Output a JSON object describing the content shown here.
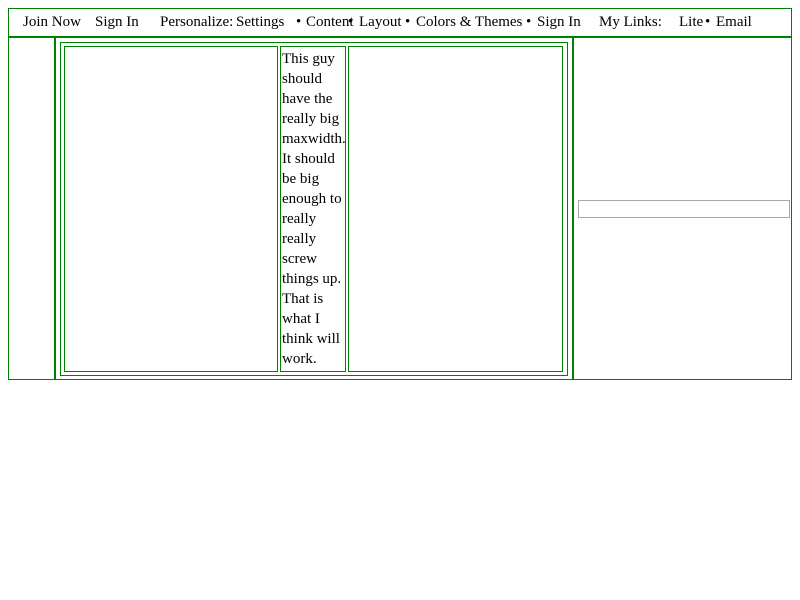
{
  "topbar": {
    "join_now": "Join Now",
    "sign_in": "Sign In",
    "personalize_label": "Personalize:",
    "personalize_links": {
      "settings": "Settings",
      "content": "Content",
      "layout": "Layout",
      "colors_themes": "Colors & Themes",
      "sign_in": "Sign In"
    },
    "separator": "•",
    "my_links_label": "My Links:",
    "my_links": {
      "lite": "Lite",
      "email": "Email"
    }
  },
  "main": {
    "middle_cell_text": "This guy should have the really big maxwidth. It should be big enough to really really screw things up. That is what I think will work."
  },
  "right": {
    "input_value": ""
  },
  "colors": {
    "border_green": "#008000",
    "input_border": "#a8a8a8"
  }
}
